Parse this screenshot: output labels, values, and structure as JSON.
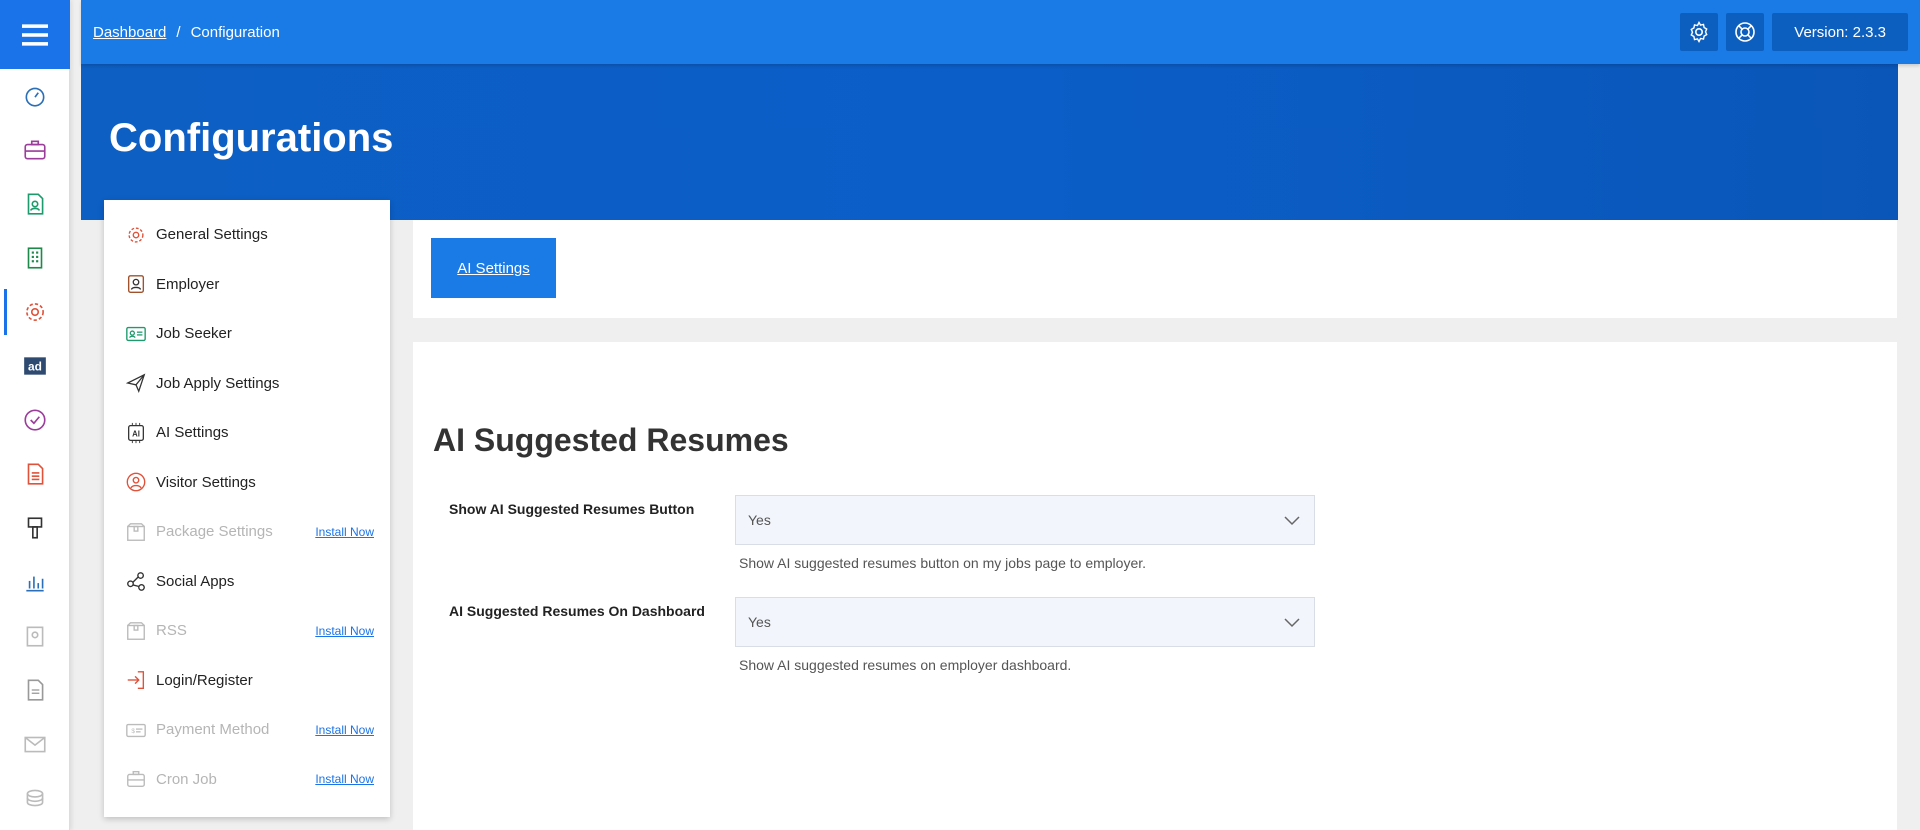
{
  "breadcrumb": {
    "home": "Dashboard",
    "separator": "/",
    "current": "Configuration"
  },
  "header": {
    "version": "Version: 2.3.3"
  },
  "page": {
    "title": "Configurations"
  },
  "rail": {
    "items": [
      "dashboard-icon",
      "briefcase-icon",
      "resume-icon",
      "building-icon",
      "gear-icon",
      "ad-icon",
      "badge-check-icon",
      "document-icon",
      "brush-icon",
      "chart-icon",
      "id-card-icon",
      "file-icon",
      "mail-icon",
      "coins-icon"
    ]
  },
  "menu": {
    "general": "General Settings",
    "employer": "Employer",
    "job_seeker": "Job Seeker",
    "job_apply": "Job Apply Settings",
    "ai": "AI Settings",
    "visitor": "Visitor Settings",
    "package": "Package Settings",
    "social": "Social Apps",
    "rss": "RSS",
    "login": "Login/Register",
    "payment": "Payment Method",
    "cron": "Cron Job",
    "install_now": "Install Now"
  },
  "tabs": {
    "ai": "AI Settings"
  },
  "section": {
    "title": "AI Suggested Resumes",
    "fields": [
      {
        "label": "Show AI Suggested Resumes Button",
        "value": "Yes",
        "help": "Show AI suggested resumes button on my jobs page to employer."
      },
      {
        "label": "AI Suggested Resumes On Dashboard",
        "value": "Yes",
        "help": "Show AI suggested resumes on employer dashboard."
      }
    ]
  },
  "colors": {
    "primary": "#1a7be6",
    "hero": "#0b5ec8",
    "dark_btn": "#0d5fbf"
  }
}
